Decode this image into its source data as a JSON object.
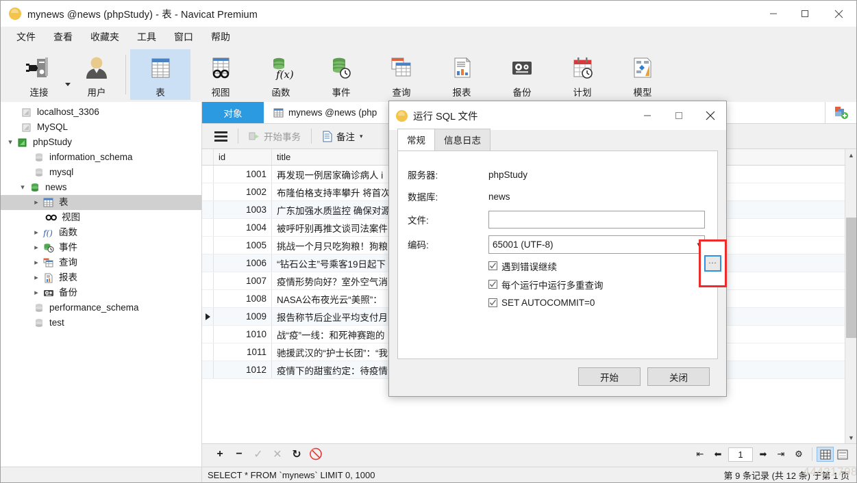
{
  "window": {
    "title": "mynews @news (phpStudy) - 表 - Navicat Premium",
    "logo_icon": "navicat-logo-icon",
    "minimize_icon": "minimize-icon",
    "maximize_icon": "maximize-icon",
    "close_icon": "close-icon"
  },
  "menu": {
    "items": [
      {
        "label": "文件",
        "name": "menu-file"
      },
      {
        "label": "查看",
        "name": "menu-view"
      },
      {
        "label": "收藏夹",
        "name": "menu-favorites"
      },
      {
        "label": "工具",
        "name": "menu-tools"
      },
      {
        "label": "窗口",
        "name": "menu-window"
      },
      {
        "label": "帮助",
        "name": "menu-help"
      }
    ]
  },
  "toolbar": {
    "items": [
      {
        "label": "连接",
        "icon": "connection-icon",
        "active": false
      },
      {
        "label": "用户",
        "icon": "user-icon",
        "active": false
      },
      {
        "label": "表",
        "icon": "table-icon",
        "active": true
      },
      {
        "label": "视图",
        "icon": "view-icon",
        "active": false
      },
      {
        "label": "函数",
        "icon": "function-icon",
        "active": false
      },
      {
        "label": "事件",
        "icon": "event-icon",
        "active": false
      },
      {
        "label": "查询",
        "icon": "query-icon",
        "active": false
      },
      {
        "label": "报表",
        "icon": "report-icon",
        "active": false
      },
      {
        "label": "备份",
        "icon": "backup-icon",
        "active": false
      },
      {
        "label": "计划",
        "icon": "schedule-icon",
        "active": false
      },
      {
        "label": "模型",
        "icon": "model-icon",
        "active": false
      }
    ]
  },
  "sidebar": {
    "items": [
      {
        "label": "localhost_3306",
        "icon": "connection-gray-icon",
        "indent": 1,
        "expander": "none",
        "selected": false
      },
      {
        "label": "MySQL",
        "icon": "connection-gray-icon",
        "indent": 1,
        "expander": "none",
        "selected": false
      },
      {
        "label": "phpStudy",
        "icon": "connection-green-icon",
        "indent": 0,
        "expander": "expanded",
        "selected": false
      },
      {
        "label": "information_schema",
        "icon": "database-gray-icon",
        "indent": 2,
        "expander": "none",
        "selected": false
      },
      {
        "label": "mysql",
        "icon": "database-gray-icon",
        "indent": 2,
        "expander": "none",
        "selected": false
      },
      {
        "label": "news",
        "icon": "database-green-icon",
        "indent": 1,
        "expander": "expanded",
        "selected": false
      },
      {
        "label": "表",
        "icon": "table-icon",
        "indent": 2,
        "expander": "collapsed",
        "selected": true
      },
      {
        "label": "视图",
        "icon": "view-icon",
        "indent": 3,
        "expander": "none",
        "selected": false
      },
      {
        "label": "函数",
        "icon": "function-icon",
        "indent": 2,
        "expander": "collapsed",
        "selected": false
      },
      {
        "label": "事件",
        "icon": "event-icon",
        "indent": 2,
        "expander": "collapsed",
        "selected": false
      },
      {
        "label": "查询",
        "icon": "query-icon",
        "indent": 2,
        "expander": "collapsed",
        "selected": false
      },
      {
        "label": "报表",
        "icon": "report-icon",
        "indent": 2,
        "expander": "collapsed",
        "selected": false
      },
      {
        "label": "备份",
        "icon": "backup-icon",
        "indent": 2,
        "expander": "collapsed",
        "selected": false
      },
      {
        "label": "performance_schema",
        "icon": "database-gray-icon",
        "indent": 2,
        "expander": "none",
        "selected": false
      },
      {
        "label": "test",
        "icon": "database-gray-icon",
        "indent": 2,
        "expander": "none",
        "selected": false
      }
    ]
  },
  "tabs": {
    "object_tab": "对象",
    "table_tab": "mynews @news (php",
    "new_tab_icon": "new-tab-icon"
  },
  "subtoolbar": {
    "menu_icon": "hamburger-menu-icon",
    "begin_transaction": "开始事务",
    "remark": "备注",
    "remark_caret_icon": "chevron-down-icon"
  },
  "grid": {
    "columns": [
      "id",
      "title"
    ],
    "rows": [
      {
        "id": "1001",
        "title": "再发现一例居家确诊病人 i",
        "marked": false
      },
      {
        "id": "1002",
        "title": "布隆伯格支持率攀升 将首次",
        "marked": false
      },
      {
        "id": "1003",
        "title": "广东加强水质监控 确保对源",
        "marked": false
      },
      {
        "id": "1004",
        "title": "被呼吁别再推文谈司法案件",
        "marked": false
      },
      {
        "id": "1005",
        "title": "挑战一个月只吃狗粮！狗粮",
        "marked": false
      },
      {
        "id": "1006",
        "title": "“钻石公主”号乘客19日起下",
        "marked": false
      },
      {
        "id": "1007",
        "title": "疫情形势向好？室外空气消",
        "marked": false
      },
      {
        "id": "1008",
        "title": "NASA公布夜光云“美照”：",
        "marked": false
      },
      {
        "id": "1009",
        "title": "报告称节后企业平均支付月",
        "marked": true
      },
      {
        "id": "1010",
        "title": "战“疫”一线：和死神赛跑的",
        "marked": false
      },
      {
        "id": "1011",
        "title": "驰援武汉的“护士长团”：“我",
        "marked": false
      },
      {
        "id": "1012",
        "title": "疫情下的甜蜜约定：待疫情",
        "marked": false
      }
    ]
  },
  "editbar": {
    "add_icon": "plus-icon",
    "delete_icon": "minus-icon",
    "confirm_icon": "check-icon",
    "cancel_icon": "cross-icon",
    "refresh_icon": "refresh-icon",
    "stop_icon": "stop-icon",
    "first_page_icon": "first-page-icon",
    "prev_page_icon": "prev-page-icon",
    "page_number": "1",
    "next_page_icon": "next-page-icon",
    "last_page_icon": "last-page-icon",
    "settings_icon": "gear-icon",
    "grid_view_icon": "grid-view-icon",
    "form_view_icon": "form-view-icon"
  },
  "statusbar": {
    "sql": "SELECT * FROM `mynews` LIMIT 0, 1000",
    "record_info": "第 9 条记录 (共 12 条) 于第 1 页",
    "watermark": "44421798"
  },
  "dialog": {
    "title": "运行 SQL 文件",
    "logo_icon": "navicat-logo-icon",
    "minimize_icon": "minimize-icon",
    "maximize_icon": "maximize-icon",
    "close_icon": "close-icon",
    "tabs": [
      {
        "label": "常规",
        "active": true
      },
      {
        "label": "信息日志",
        "active": false
      }
    ],
    "fields": {
      "server_label": "服务器:",
      "server_value": "phpStudy",
      "database_label": "数据库:",
      "database_value": "news",
      "file_label": "文件:",
      "file_value": "",
      "encoding_label": "编码:",
      "encoding_value": "65001 (UTF-8)",
      "browse_button_label": "...",
      "dropdown_icon": "chevron-down-icon"
    },
    "checkboxes": [
      {
        "label": "遇到错误继续",
        "checked": true
      },
      {
        "label": "每个运行中运行多重查询",
        "checked": true
      },
      {
        "label": "SET AUTOCOMMIT=0",
        "checked": true
      }
    ],
    "buttons": {
      "start": "开始",
      "close": "关闭"
    },
    "highlight_color": "#ee2b2b",
    "focus_color": "#2f90e0"
  }
}
